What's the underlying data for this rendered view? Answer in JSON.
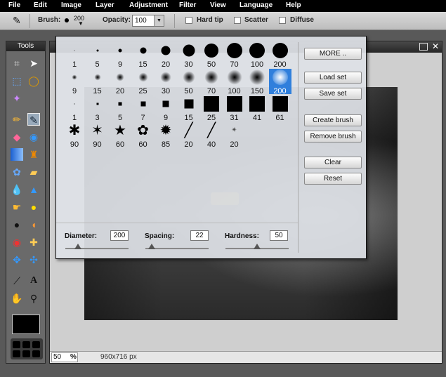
{
  "menu": [
    "File",
    "Edit",
    "Image",
    "Layer",
    "Adjustment",
    "Filter",
    "View",
    "Language",
    "Help"
  ],
  "options": {
    "brush_label": "Brush:",
    "brush_size": "200",
    "opacity_label": "Opacity:",
    "opacity_value": "100",
    "hard_tip": "Hard tip",
    "scatter": "Scatter",
    "diffuse": "Diffuse"
  },
  "tools_title": "Tools",
  "palette": {
    "rows": [
      [
        "1",
        "5",
        "9",
        "15",
        "20",
        "30",
        "50",
        "70",
        "100",
        "200"
      ],
      [
        "9",
        "15",
        "20",
        "25",
        "30",
        "50",
        "70",
        "100",
        "150",
        "200"
      ],
      [
        "1",
        "3",
        "5",
        "7",
        "9",
        "15",
        "25",
        "31",
        "41",
        "61"
      ],
      [
        "90",
        "90",
        "60",
        "60",
        "85",
        "20",
        "40",
        "20"
      ]
    ],
    "selected_label": "200",
    "buttons": {
      "more": "MORE ..",
      "load_set": "Load set",
      "save_set": "Save set",
      "create_brush": "Create brush",
      "remove_brush": "Remove brush",
      "clear": "Clear",
      "reset": "Reset"
    },
    "diameter_label": "Diameter:",
    "diameter_value": "200",
    "spacing_label": "Spacing:",
    "spacing_value": "22",
    "hardness_label": "Hardness:",
    "hardness_value": "50"
  },
  "status": {
    "zoom": "50",
    "zoom_unit": "%",
    "dimensions": "960x716 px"
  }
}
